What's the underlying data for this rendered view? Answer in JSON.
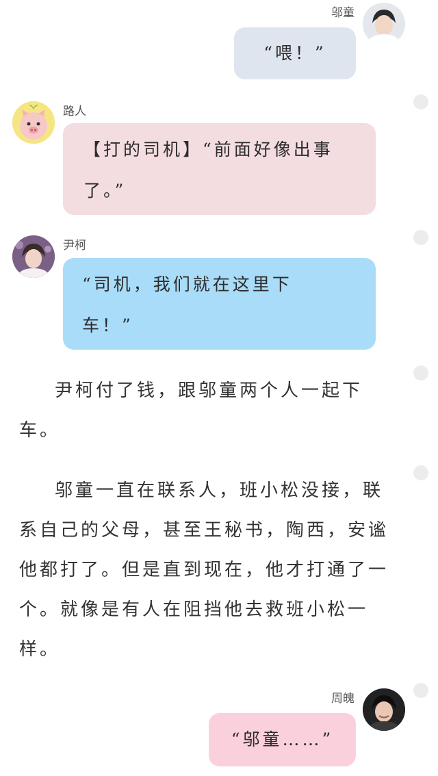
{
  "messages": [
    {
      "speaker": "邬童",
      "text": "“喂！”",
      "bubble_color": "#dfe5ee"
    },
    {
      "speaker": "路人",
      "text": "【打的司机】“前面好像出事了。”",
      "bubble_color": "#f3dde0"
    },
    {
      "speaker": "尹柯",
      "text": "“司机，我们就在这里下车！”",
      "bubble_color": "#a9dcf9"
    },
    {
      "speaker": "周魄",
      "text": "“邬童……”",
      "bubble_color": "#fbd0dd"
    }
  ],
  "paragraphs": [
    "尹柯付了钱，跟邬童两个人一起下车。",
    "邬童一直在联系人，班小松没接，联系自己的父母，甚至王秘书，陶西，安谧他都打了。但是直到现在，他才打通了一个。就像是有人在阻挡他去救班小松一样。"
  ]
}
